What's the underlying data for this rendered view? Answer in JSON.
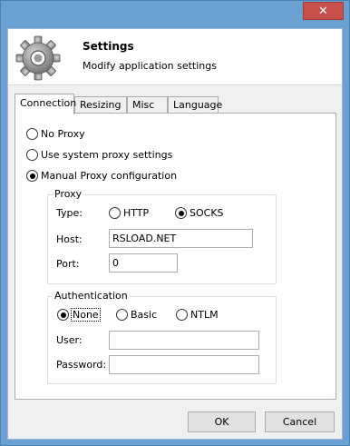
{
  "dialog": {
    "close_glyph": "✕",
    "header_title": "Settings",
    "header_subtitle": "Modify application settings"
  },
  "tabs": [
    {
      "label": "Connection",
      "active": true
    },
    {
      "label": "Resizing",
      "active": false
    },
    {
      "label": "Misc",
      "active": false
    },
    {
      "label": "Language",
      "active": false
    }
  ],
  "connection": {
    "proxy_modes": [
      {
        "label": "No Proxy",
        "checked": false
      },
      {
        "label": "Use system proxy settings",
        "checked": false
      },
      {
        "label": "Manual Proxy configuration",
        "checked": true
      }
    ],
    "proxy_group": {
      "caption": "Proxy",
      "type_label": "Type:",
      "type_options": [
        {
          "label": "HTTP",
          "checked": false
        },
        {
          "label": "SOCKS",
          "checked": true
        }
      ],
      "host_label": "Host:",
      "host_value": "RSLOAD.NET",
      "port_label": "Port:",
      "port_value": "0"
    },
    "auth_group": {
      "caption": "Authentication",
      "options": [
        {
          "label": "None",
          "checked": true
        },
        {
          "label": "Basic",
          "checked": false
        },
        {
          "label": "NTLM",
          "checked": false
        }
      ],
      "user_label": "User:",
      "user_value": "",
      "password_label": "Password:",
      "password_value": ""
    }
  },
  "buttons": {
    "ok_label": "OK",
    "cancel_label": "Cancel"
  },
  "colors": {
    "frame": "#6ba0d2",
    "close_button": "#c7504a",
    "client_bg": "#f0f0f0"
  }
}
